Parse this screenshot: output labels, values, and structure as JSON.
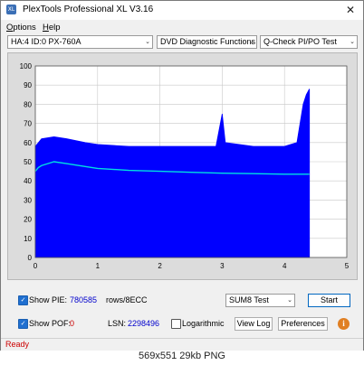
{
  "window": {
    "title": "PlexTools Professional XL V3.16",
    "icon_text": "XL"
  },
  "menu": [
    "Options",
    "Help"
  ],
  "selectors": {
    "drive": "HA:4 ID:0  PX-760A",
    "function": "DVD Diagnostic Functions",
    "test": "Q-Check PI/PO Test"
  },
  "chart_data": {
    "type": "area",
    "title": "",
    "xlabel": "",
    "ylabel": "",
    "xlim": [
      0,
      5
    ],
    "ylim": [
      0,
      100
    ],
    "x_ticks": [
      0,
      1,
      2,
      3,
      4,
      5
    ],
    "y_ticks": [
      0,
      10,
      20,
      30,
      40,
      50,
      60,
      70,
      80,
      90,
      100
    ],
    "grid": true,
    "series": [
      {
        "name": "",
        "color": "#0000ff",
        "x": [
          0,
          0.1,
          0.3,
          0.5,
          0.8,
          1.0,
          1.5,
          2.0,
          2.5,
          2.9,
          3.0,
          3.05,
          3.5,
          4.0,
          4.2,
          4.3,
          4.35,
          4.4
        ],
        "values": [
          58,
          62,
          63,
          62,
          60,
          59,
          58,
          58,
          58,
          58,
          75,
          60,
          58,
          58,
          60,
          80,
          85,
          88
        ]
      },
      {
        "name": "",
        "color": "#00e0e0",
        "x": [
          0,
          0.05,
          0.1,
          0.2,
          0.3,
          0.5,
          0.8,
          1.0,
          1.5,
          2.0,
          2.5,
          3.0,
          3.5,
          4.0,
          4.4
        ],
        "values": [
          45,
          47,
          48,
          49,
          50,
          49,
          47.5,
          46.5,
          45.5,
          45,
          44.5,
          44,
          43.8,
          43.5,
          43.5
        ]
      }
    ]
  },
  "controls": {
    "show_pie_label": "Show PIE:",
    "pie_value": "780585",
    "rows_label": "rows/8ECC",
    "show_pof_label": "Show POF:",
    "pof_value": "0",
    "lsn_label": "LSN:",
    "lsn_value": "2298496",
    "logarithmic_label": "Logarithmic",
    "sum_select": "SUM8 Test",
    "start_button": "Start",
    "viewlog_button": "View Log",
    "preferences_button": "Preferences",
    "checkbox_check": "✓"
  },
  "status": {
    "text": "Ready"
  },
  "caption": "569x551 29kb PNG",
  "icons": {
    "close": "✕",
    "dropdown": "⌄",
    "info": "i"
  }
}
